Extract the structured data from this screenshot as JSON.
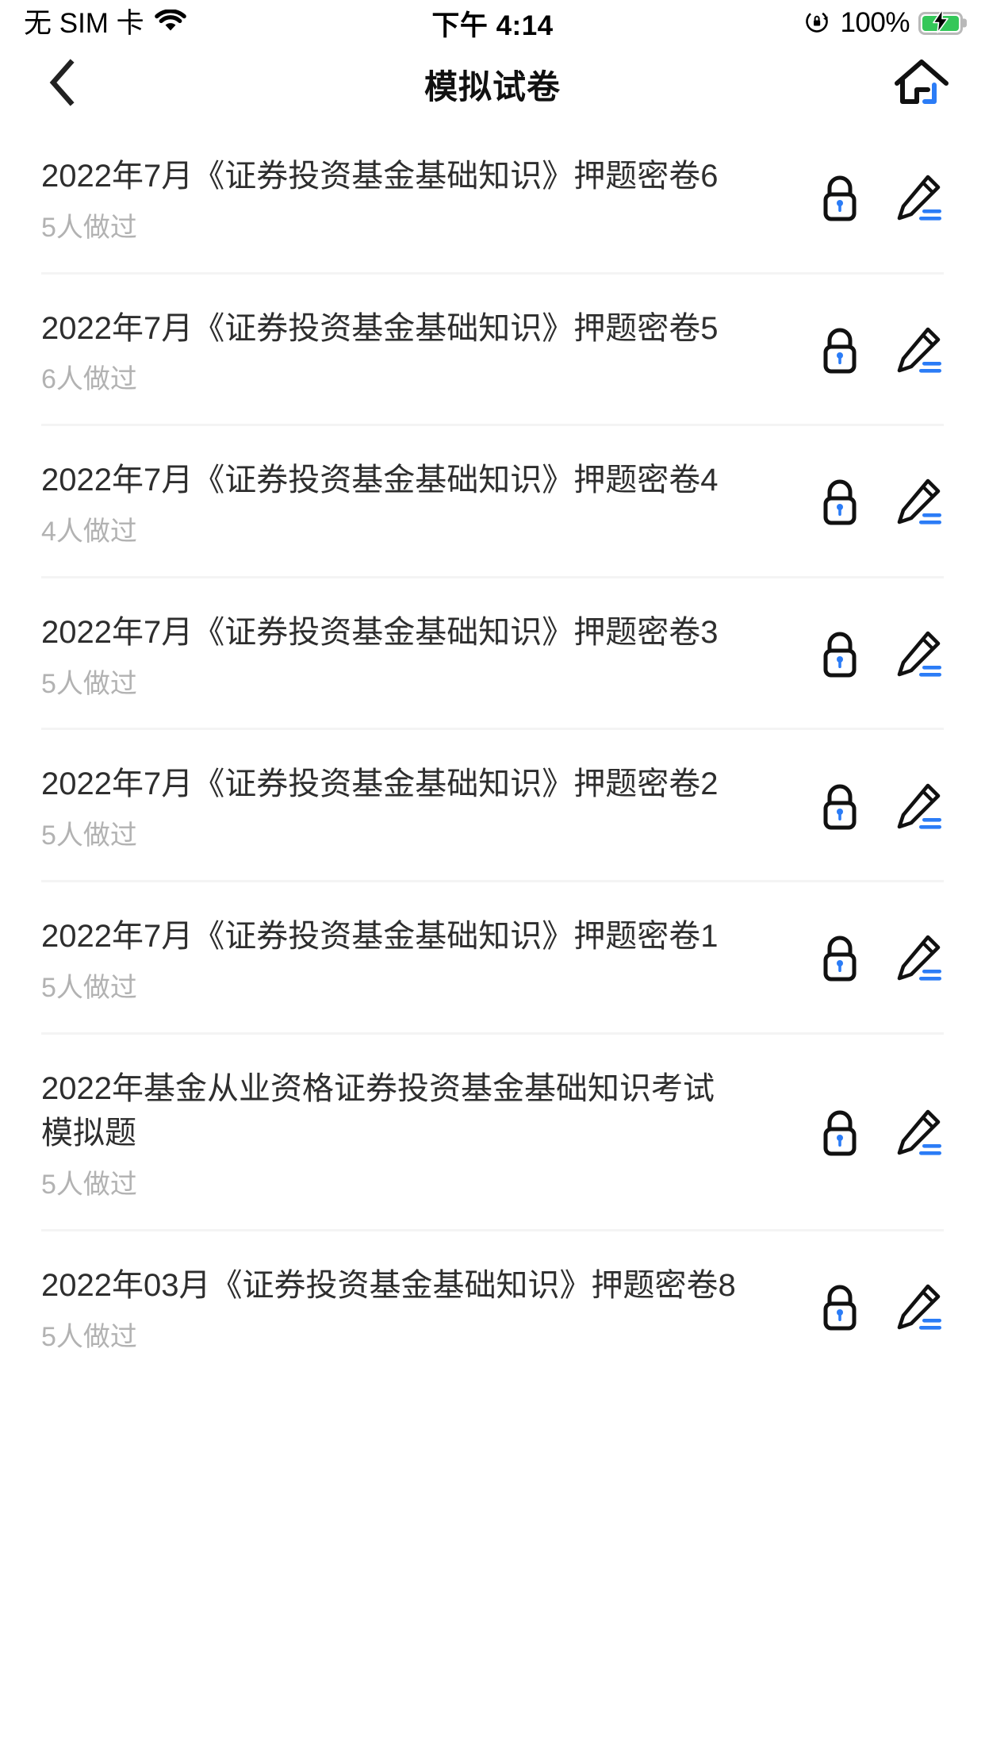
{
  "status_bar": {
    "carrier": "无 SIM 卡",
    "wifi_icon": "wifi-icon",
    "time": "下午 4:14",
    "rotation_lock_icon": "rotation-lock-icon",
    "battery_percent": "100%",
    "battery_icon": "battery-charging-icon",
    "battery_color": "#34c759"
  },
  "nav": {
    "back_icon": "chevron-left-icon",
    "title": "模拟试卷",
    "home_icon": "home-icon",
    "accent_color": "#2b7cf6"
  },
  "colors": {
    "title_text": "#2e2e2e",
    "meta_text": "#b2b2b2",
    "divider": "#f4f4f4",
    "icon_outline": "#111111",
    "icon_accent": "#2b7cf6"
  },
  "list": {
    "lock_icon": "lock-icon",
    "edit_icon": "pencil-edit-icon",
    "items": [
      {
        "title": "2022年7月《证券投资基金基础知识》押题密卷6",
        "meta": "5人做过"
      },
      {
        "title": "2022年7月《证券投资基金基础知识》押题密卷5",
        "meta": "6人做过"
      },
      {
        "title": "2022年7月《证券投资基金基础知识》押题密卷4",
        "meta": "4人做过"
      },
      {
        "title": "2022年7月《证券投资基金基础知识》押题密卷3",
        "meta": "5人做过"
      },
      {
        "title": "2022年7月《证券投资基金基础知识》押题密卷2",
        "meta": "5人做过"
      },
      {
        "title": "2022年7月《证券投资基金基础知识》押题密卷1",
        "meta": "5人做过"
      },
      {
        "title": "2022年基金从业资格证券投资基金基础知识考试模拟题",
        "meta": "5人做过"
      },
      {
        "title": "2022年03月《证券投资基金基础知识》押题密卷8",
        "meta": "5人做过"
      }
    ]
  }
}
